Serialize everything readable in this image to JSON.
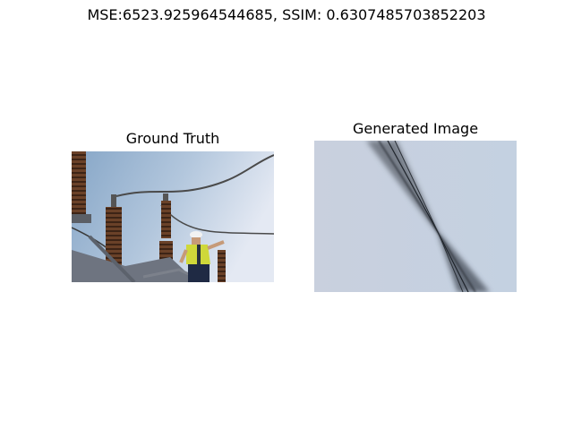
{
  "figure": {
    "suptitle": "MSE:6523.925964544685, SSIM: 0.6307485703852203"
  },
  "panels": [
    {
      "title": "Ground Truth",
      "image_description": "Utility worker in hard hat and hi-vis vest working on high-voltage insulators against a blue sky"
    },
    {
      "title": "Generated Image",
      "image_description": "Pale blue-grey field crossed by dark diagonal streaks converging to a point"
    }
  ]
}
